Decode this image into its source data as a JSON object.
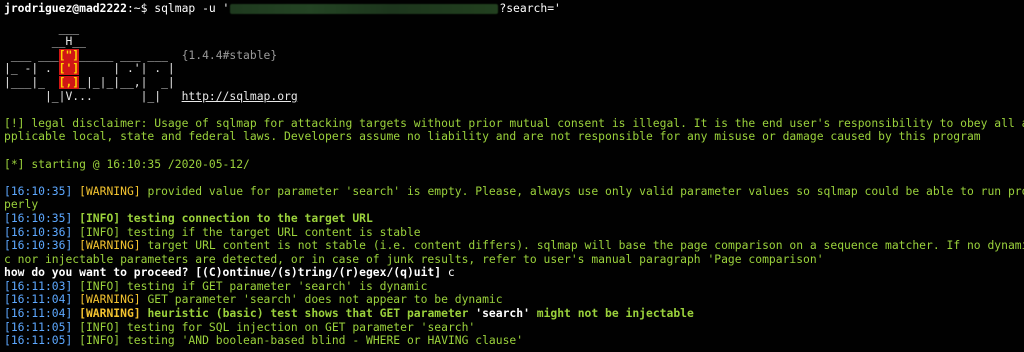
{
  "prompt": {
    "user_host": "jrodriguez@mad2222",
    "path_symbol": ":~$ ",
    "command_start": "sqlmap -u '",
    "command_end": "?search='"
  },
  "banner": {
    "l1": "        ___",
    "l2a": "       __H__",
    "l3a": " ___ ___",
    "l3b": "[\"]",
    "l3c": "_____ ___ ___  ",
    "l3d": "{1.4.4#stable}",
    "l4a": "|_ -| . ",
    "l4b": "[']",
    "l4c": "     | .'| . |",
    "l5a": "|___|_  ",
    "l5b": "[,]",
    "l5c": "_|_|_|__,|  _|",
    "l6a": "      |_|V...       |_|   ",
    "l6b": "http://sqlmap.org"
  },
  "disclaimer": {
    "line1": "[!] legal disclaimer: Usage of sqlmap for attacking targets without prior mutual consent is illegal. It is the end user's responsibility to obey all a",
    "line2": "pplicable local, state and federal laws. Developers assume no liability and are not responsible for any misuse or damage caused by this program"
  },
  "starting": "[*] starting @ 16:10:35 /2020-05-12/",
  "log": [
    {
      "ts": "[16:10:35]",
      "level": "[WARNING]",
      "msg": " provided value for parameter 'search' is empty. Please, always use only valid parameter values so sqlmap could be able to run pro"
    },
    {
      "cont": "perly"
    },
    {
      "ts": "[16:10:35]",
      "level": "[INFO]",
      "msg": " testing connection to the target URL"
    },
    {
      "ts": "[16:10:36]",
      "level": "[INFO]",
      "msg": " testing if the target URL content is stable"
    },
    {
      "ts": "[16:10:36]",
      "level": "[WARNING]",
      "msg": " target URL content is not stable (i.e. content differs). sqlmap will base the page comparison on a sequence matcher. If no dynami"
    },
    {
      "cont": "c nor injectable parameters are detected, or in case of junk results, refer to user's manual paragraph 'Page comparison'"
    },
    {
      "question": "how do you want to proceed? [(C)ontinue/(s)tring/(r)egex/(q)uit] ",
      "answer": "c"
    },
    {
      "ts": "[16:11:03]",
      "level": "[INFO]",
      "msg": " testing if GET parameter 'search' is dynamic"
    },
    {
      "ts": "[16:11:04]",
      "level": "[WARNING]",
      "msg": " GET parameter 'search' does not appear to be dynamic"
    },
    {
      "ts": "[16:11:04]",
      "level": "[WARNING]",
      "msg_a": " heuristic (basic) test shows that GET parameter ",
      "msg_b": "'search'",
      "msg_c": " might not be injectable"
    },
    {
      "ts": "[16:11:05]",
      "level": "[INFO]",
      "msg": " testing for SQL injection on GET parameter 'search'"
    },
    {
      "ts": "[16:11:05]",
      "level": "[INFO]",
      "msg": " testing 'AND boolean-based blind - WHERE or HAVING clause'"
    }
  ],
  "colors": {
    "background": "#010101",
    "text_green": "#9bd23c",
    "timestamp_blue": "#5da8ff",
    "warning_yellow": "#f4c430",
    "banner_red": "#d01515"
  }
}
